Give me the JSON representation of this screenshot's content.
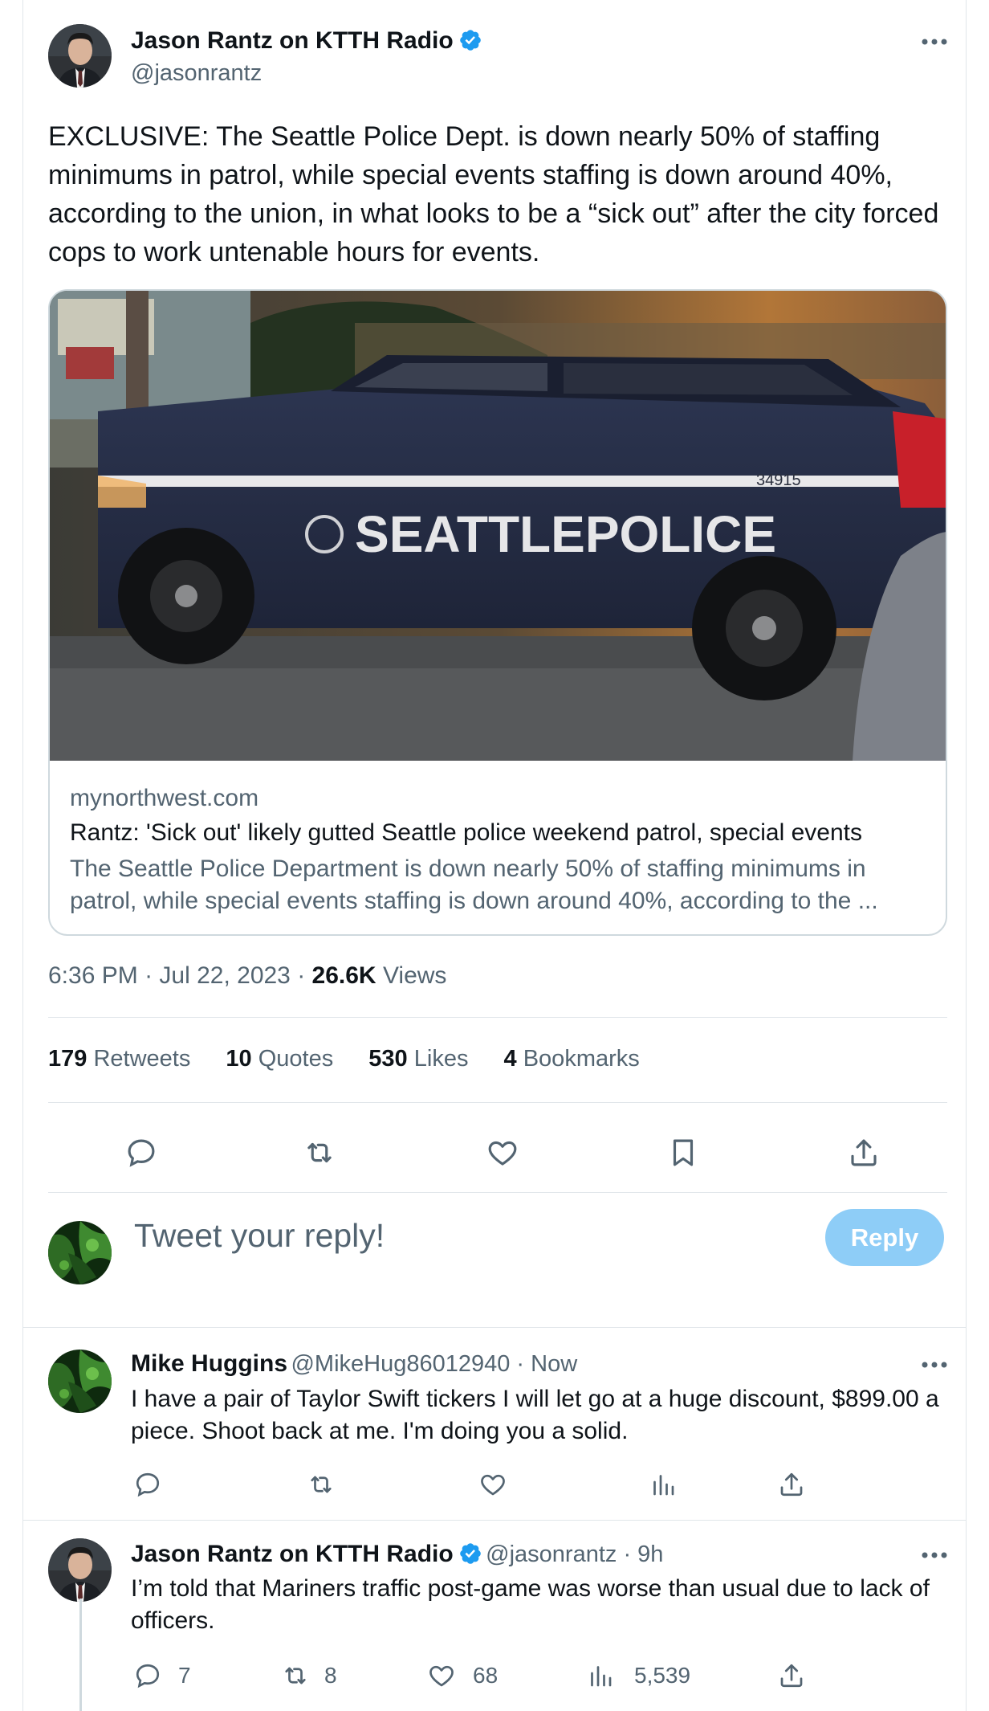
{
  "tweet": {
    "author_name": "Jason Rantz on KTTH Radio",
    "author_handle": "@jasonrantz",
    "text": "EXCLUSIVE: The Seattle Police Dept. is down nearly 50% of staffing minimums in patrol, while special events staffing is down around 40%, according to the union, in what looks to be a “sick out” after the city forced cops to work untenable hours for events.",
    "card": {
      "image_text": "SEATTLEPOLICE",
      "unit_number": "34915",
      "domain": "mynorthwest.com",
      "title": "Rantz: 'Sick out' likely gutted Seattle police weekend patrol, special events",
      "description": "The Seattle Police Department is down nearly 50% of staffing minimums in patrol, while special events staffing is down around 40%, according to the ..."
    },
    "time": "6:36 PM",
    "sep1": " · ",
    "date": "Jul 22, 2023",
    "sep2": " · ",
    "views_count": "26.6K",
    "views_label": " Views",
    "stats": {
      "retweets_count": "179",
      "retweets_label": " Retweets",
      "quotes_count": "10",
      "quotes_label": " Quotes",
      "likes_count": "530",
      "likes_label": " Likes",
      "bookmarks_count": "4",
      "bookmarks_label": " Bookmarks"
    },
    "actions": [
      "reply-icon",
      "retweet-icon",
      "like-icon",
      "bookmark-icon",
      "share-icon"
    ]
  },
  "composer": {
    "placeholder": "Tweet your reply!",
    "reply_button": "Reply"
  },
  "replies": [
    {
      "name": "Mike Huggins",
      "handle": "@MikeHug86012940",
      "sep": " · ",
      "time": "Now",
      "text": "I have a pair of Taylor Swift tickers I will let go at a huge discount, $899.00 a piece. Shoot back at me. I'm doing you a solid.",
      "verified": false
    },
    {
      "name": "Jason Rantz on KTTH Radio",
      "handle": "@jasonrantz",
      "sep": " · ",
      "time": "9h",
      "text": "I’m told that Mariners traffic post-game was worse than usual due to lack of officers.",
      "verified": true,
      "counts": {
        "replies": "7",
        "retweets": "8",
        "likes": "68",
        "views": "5,539"
      }
    }
  ],
  "colors": {
    "accent": "#1d9bf0",
    "reply_button_disabled": "#8ecdf7",
    "secondary_text": "#536471",
    "border": "#e1e6ea"
  }
}
